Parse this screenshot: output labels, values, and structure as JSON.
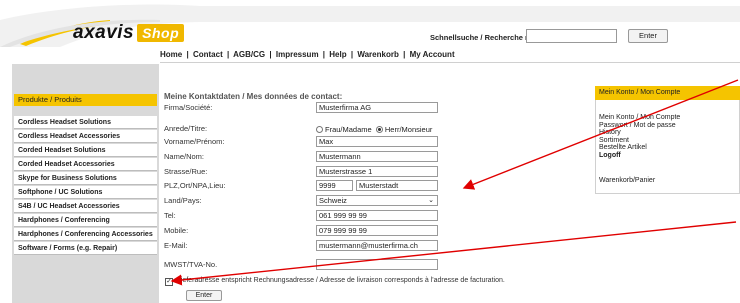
{
  "header": {
    "logo_main": "axavis",
    "logo_shop": "Shop",
    "quick_search_label": "Schnellsuche / Recherche rapide:",
    "quick_search_value": "",
    "enter_label": "Enter"
  },
  "nav": {
    "items": [
      "Home",
      "Contact",
      "AGB/CG",
      "Impressum",
      "Help",
      "Warenkorb",
      "My Account"
    ],
    "separator": "|"
  },
  "sidebar": {
    "active": "Produkte / Produits",
    "items": [
      "Cordless Headset Solutions",
      "Cordless Headset Accessories",
      "Corded Headset Solutions",
      "Corded Headset Accessories",
      "Skype for Business Solutions",
      "Softphone / UC Solutions",
      "S4B / UC Headset Accessories",
      "Hardphones / Conferencing",
      "Hardphones / Conferencing Accessories",
      "Software / Forms (e.g. Repair)"
    ]
  },
  "form": {
    "title": "Meine Kontaktdaten / Mes données de contact:",
    "company_label": "Firma/Société:",
    "company_value": "Musterfirma AG",
    "salutation_label": "Anrede/Titre:",
    "salutation_options": [
      "Frau/Madame",
      "Herr/Monsieur"
    ],
    "salutation_selected": "Herr/Monsieur",
    "firstname_label": "Vorname/Prénom:",
    "firstname_value": "Max",
    "lastname_label": "Name/Nom:",
    "lastname_value": "Mustermann",
    "street_label": "Strasse/Rue:",
    "street_value": "Musterstrasse 1",
    "city_label": "PLZ,Ort/NPA,Lieu:",
    "zip_value": "9999",
    "city_value": "Musterstadt",
    "country_label": "Land/Pays:",
    "country_value": "Schweiz",
    "tel_label": "Tel:",
    "tel_value": "061 999 99 99",
    "mobile_label": "Mobile:",
    "mobile_value": "079 999 99 99",
    "email_label": "E-Mail:",
    "email_value": "mustermann@musterfirma.ch",
    "vat_label": "MWST/TVA-No.",
    "vat_value": "",
    "delivery_checkbox_label": "Lieferadresse entspricht Rechnungsadresse / Adresse de livraison corresponds à l'adresse de facturation.",
    "delivery_checked": true,
    "submit_label": "Enter"
  },
  "account": {
    "title": "Mein Konto / Mon Compte",
    "links": [
      "Mein Konto / Mon Compte",
      "Passwort / Mot de passe",
      "History",
      "Sortiment",
      "Bestellte Artikel"
    ],
    "logoff": "Logoff",
    "cart": "Warenkorb/Panier"
  },
  "colors": {
    "accent": "#f5c400",
    "sidebar_bg": "#d9d9d9",
    "annotation": "#e00000"
  }
}
